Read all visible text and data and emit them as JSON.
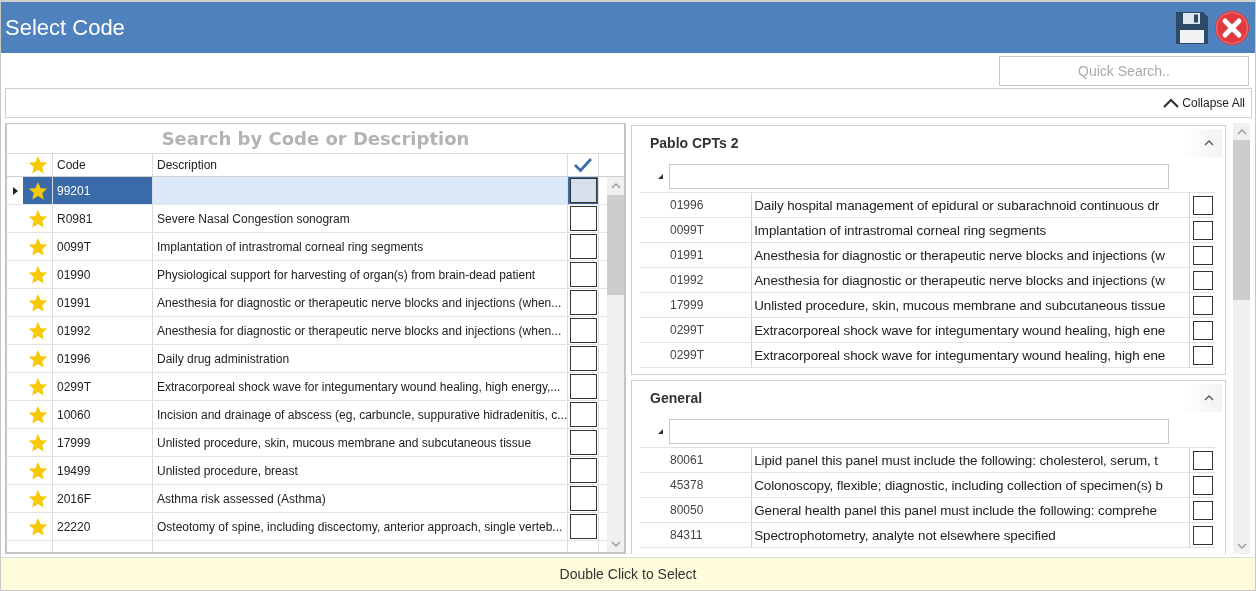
{
  "window": {
    "title": "Select Code"
  },
  "quick_search": {
    "placeholder": "Quick Search.."
  },
  "collapse_all": {
    "label": "Collapse All"
  },
  "code_grid": {
    "search_placeholder": "Search by Code or Description",
    "columns": [
      "Code",
      "Description"
    ],
    "rows": [
      {
        "code": "99201",
        "description": "",
        "favorite": true,
        "checked": false,
        "selected": true
      },
      {
        "code": "R0981",
        "description": "Severe Nasal Congestion sonogram",
        "favorite": true,
        "checked": false,
        "selected": false
      },
      {
        "code": "0099T",
        "description": "Implantation of intrastromal corneal ring segments",
        "favorite": true,
        "checked": false,
        "selected": false
      },
      {
        "code": "01990",
        "description": "Physiological support for harvesting of organ(s) from brain-dead patient",
        "favorite": true,
        "checked": false,
        "selected": false
      },
      {
        "code": "01991",
        "description": "Anesthesia for diagnostic or therapeutic nerve blocks and injections (when...",
        "favorite": true,
        "checked": false,
        "selected": false
      },
      {
        "code": "01992",
        "description": "Anesthesia for diagnostic or therapeutic nerve blocks and injections (when...",
        "favorite": true,
        "checked": false,
        "selected": false
      },
      {
        "code": "01996",
        "description": "Daily drug administration",
        "favorite": true,
        "checked": false,
        "selected": false
      },
      {
        "code": "0299T",
        "description": "Extracorporeal shock wave for integumentary wound healing, high energy,...",
        "favorite": true,
        "checked": false,
        "selected": false
      },
      {
        "code": "10060",
        "description": "Incision and drainage of abscess (eg, carbuncle, suppurative hidradenitis, c...",
        "favorite": true,
        "checked": false,
        "selected": false
      },
      {
        "code": "17999",
        "description": "Unlisted procedure, skin, mucous membrane and subcutaneous tissue",
        "favorite": true,
        "checked": false,
        "selected": false
      },
      {
        "code": "19499",
        "description": "Unlisted procedure, breast",
        "favorite": true,
        "checked": false,
        "selected": false
      },
      {
        "code": "2016F",
        "description": "Asthma risk assessed (Asthma)",
        "favorite": true,
        "checked": false,
        "selected": false
      },
      {
        "code": "22220",
        "description": "Osteotomy of spine, including discectomy, anterior approach, single verteb...",
        "favorite": true,
        "checked": false,
        "selected": false
      }
    ]
  },
  "groups": [
    {
      "title": "Pablo CPTs 2",
      "expanded": true,
      "rows": [
        {
          "code": "01996",
          "description": "Daily hospital management of epidural or subarachnoid continuous dr",
          "checked": false
        },
        {
          "code": "0099T",
          "description": "Implantation of intrastromal corneal ring segments",
          "checked": false
        },
        {
          "code": "01991",
          "description": "Anesthesia for diagnostic or therapeutic nerve blocks and injections (w",
          "checked": false
        },
        {
          "code": "01992",
          "description": "Anesthesia for diagnostic or therapeutic nerve blocks and injections (w",
          "checked": false
        },
        {
          "code": "17999",
          "description": "Unlisted procedure, skin, mucous membrane and subcutaneous tissue",
          "checked": false
        },
        {
          "code": "0299T",
          "description": "Extracorporeal shock wave for integumentary wound healing, high ene",
          "checked": false
        },
        {
          "code": "0299T",
          "description": "Extracorporeal shock wave for integumentary wound healing, high ene",
          "checked": false
        }
      ]
    },
    {
      "title": "General",
      "expanded": true,
      "rows": [
        {
          "code": "80061",
          "description": "Lipid panel this panel must include the following: cholesterol, serum, t",
          "checked": false
        },
        {
          "code": "45378",
          "description": "Colonoscopy, flexible; diagnostic, including collection of specimen(s) b",
          "checked": false
        },
        {
          "code": "80050",
          "description": "General health panel this panel must include the following: comprehe",
          "checked": false
        },
        {
          "code": "84311",
          "description": "Spectrophotometry, analyte not elsewhere specified",
          "checked": false
        }
      ]
    }
  ],
  "status_bar": {
    "text": "Double Click to Select"
  }
}
